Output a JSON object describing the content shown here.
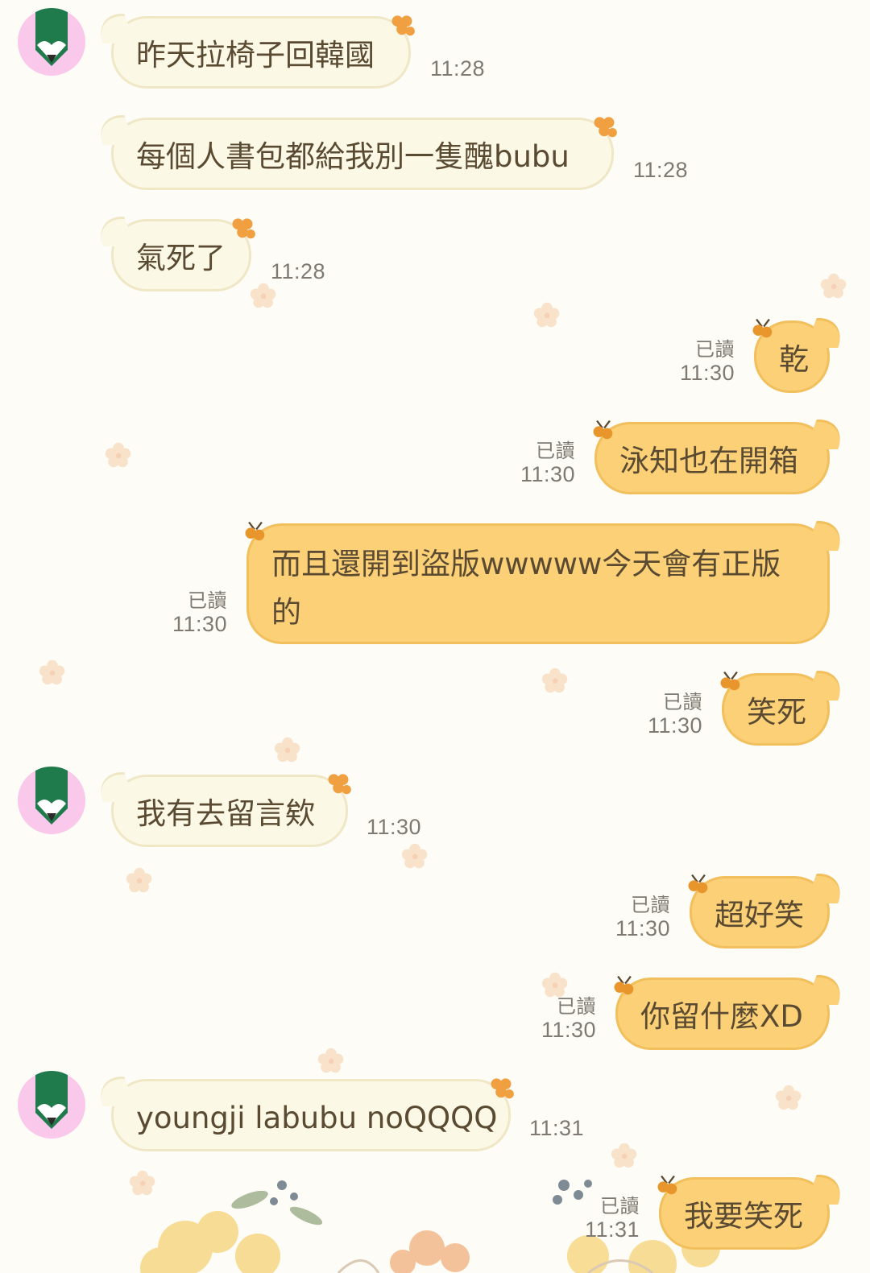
{
  "messages": [
    {
      "text": "昨天拉椅子回韓國",
      "time": "11:28"
    },
    {
      "text": "每個人書包都給我別一隻醜bubu",
      "time": "11:28"
    },
    {
      "text": "氣死了",
      "time": "11:28"
    },
    {
      "text": "乾",
      "time": "11:30",
      "read": "已讀"
    },
    {
      "text": "泳知也在開箱",
      "time": "11:30",
      "read": "已讀"
    },
    {
      "text": "而且還開到盜版wwwww今天會有正版的",
      "time": "11:30",
      "read": "已讀"
    },
    {
      "text": "笑死",
      "time": "11:30",
      "read": "已讀"
    },
    {
      "text": "我有去留言欸",
      "time": "11:30"
    },
    {
      "text": "超好笑",
      "time": "11:30",
      "read": "已讀"
    },
    {
      "text": "你留什麼XD",
      "time": "11:30",
      "read": "已讀"
    },
    {
      "text": "youngji labubu noQQQQ",
      "time": "11:31"
    },
    {
      "text": "我要笑死",
      "time": "11:31",
      "read": "已讀"
    }
  ],
  "colors": {
    "background": "#fdfcf6",
    "incoming_bubble": "#fbf8e6",
    "outgoing_bubble": "#fbd077",
    "avatar_bg": "#f9c8ea",
    "avatar_icon": "#1f7a4c"
  },
  "icons": {
    "avatar": "green-pencil-heart-icon",
    "bubble_charm": "flower-charm-icon",
    "background": "flower-icon"
  }
}
